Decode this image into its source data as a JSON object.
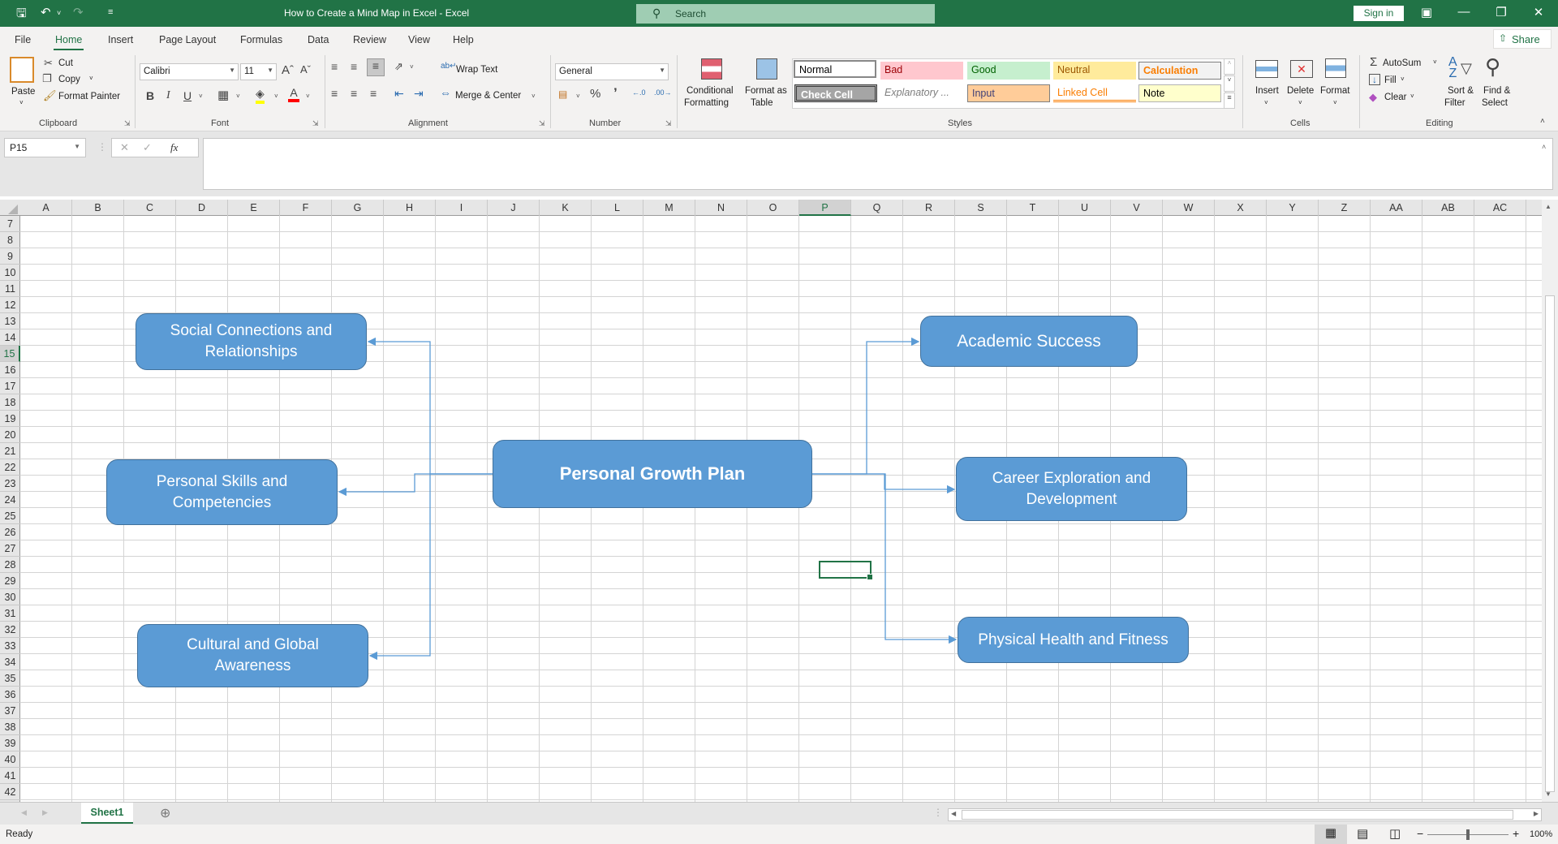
{
  "window": {
    "title": "How to Create a Mind Map in Excel  -  Excel",
    "search_placeholder": "Search",
    "sign_in": "Sign in"
  },
  "menu_tabs": [
    "File",
    "Home",
    "Insert",
    "Page Layout",
    "Formulas",
    "Data",
    "Review",
    "View",
    "Help"
  ],
  "active_tab": "Home",
  "share_label": "Share",
  "ribbon": {
    "clipboard": {
      "label": "Clipboard",
      "paste": "Paste",
      "cut": "Cut",
      "copy": "Copy",
      "format_painter": "Format Painter"
    },
    "font": {
      "label": "Font",
      "font_name": "Calibri",
      "font_size": "11",
      "bold": "B",
      "italic": "I",
      "underline": "U"
    },
    "alignment": {
      "label": "Alignment",
      "wrap_text": "Wrap Text",
      "merge_center": "Merge & Center"
    },
    "number": {
      "label": "Number",
      "format": "General"
    },
    "styles": {
      "label": "Styles",
      "conditional_formatting": [
        "Conditional",
        "Formatting"
      ],
      "format_as_table": [
        "Format as",
        "Table"
      ],
      "gallery": [
        {
          "name": "Normal",
          "bg": "#ffffff",
          "fg": "#000000"
        },
        {
          "name": "Bad",
          "bg": "#ffc7ce",
          "fg": "#9c0006"
        },
        {
          "name": "Good",
          "bg": "#c6efce",
          "fg": "#006100"
        },
        {
          "name": "Neutral",
          "bg": "#ffeb9c",
          "fg": "#9c5700"
        },
        {
          "name": "Calculation",
          "bg": "#f2f2f2",
          "fg": "#fa7d00"
        },
        {
          "name": "Check Cell",
          "bg": "#a5a5a5",
          "fg": "#ffffff"
        },
        {
          "name": "Explanatory ...",
          "bg": "#ffffff",
          "fg": "#7f7f7f"
        },
        {
          "name": "Input",
          "bg": "#ffcc99",
          "fg": "#3f3f76"
        },
        {
          "name": "Linked Cell",
          "bg": "#ffffff",
          "fg": "#fa7d00"
        },
        {
          "name": "Note",
          "bg": "#ffffcc",
          "fg": "#000000"
        }
      ]
    },
    "cells": {
      "label": "Cells",
      "insert": "Insert",
      "delete": "Delete",
      "format": "Format"
    },
    "editing": {
      "label": "Editing",
      "autosum": "AutoSum",
      "fill": "Fill",
      "clear": "Clear",
      "sort_filter": [
        "Sort &",
        "Filter"
      ],
      "find_select": [
        "Find &",
        "Select"
      ]
    }
  },
  "formula_bar": {
    "name_box": "P15",
    "formula": ""
  },
  "columns": [
    "A",
    "B",
    "C",
    "D",
    "E",
    "F",
    "G",
    "H",
    "I",
    "J",
    "K",
    "L",
    "M",
    "N",
    "O",
    "P",
    "Q",
    "R",
    "S",
    "T",
    "U",
    "V",
    "W",
    "X",
    "Y",
    "Z",
    "AA",
    "AB",
    "AC"
  ],
  "rows": [
    7,
    8,
    9,
    10,
    11,
    12,
    13,
    14,
    15,
    16,
    17,
    18,
    19,
    20,
    21,
    22,
    23,
    24,
    25,
    26,
    27,
    28,
    29,
    30,
    31,
    32,
    33,
    34,
    35,
    36,
    37,
    38,
    39,
    40,
    41,
    42
  ],
  "selected_cell": {
    "column": "P",
    "row": 15
  },
  "mind_map": {
    "center": "Personal Growth Plan",
    "branches": [
      {
        "id": "social",
        "label": "Social Connections and Relationships",
        "side": "left"
      },
      {
        "id": "skills",
        "label": "Personal Skills and Competencies",
        "side": "left"
      },
      {
        "id": "cultural",
        "label": "Cultural and Global Awareness",
        "side": "left"
      },
      {
        "id": "academic",
        "label": "Academic Success",
        "side": "right"
      },
      {
        "id": "career",
        "label": "Career Exploration and Development",
        "side": "right"
      },
      {
        "id": "health",
        "label": "Physical Health and Fitness",
        "side": "right"
      }
    ],
    "colors": {
      "fill": "#5b9bd5",
      "border": "#41719c",
      "connector": "#5b9bd5"
    }
  },
  "sheets": [
    "Sheet1"
  ],
  "active_sheet": "Sheet1",
  "status": {
    "text": "Ready",
    "zoom": "100%"
  }
}
